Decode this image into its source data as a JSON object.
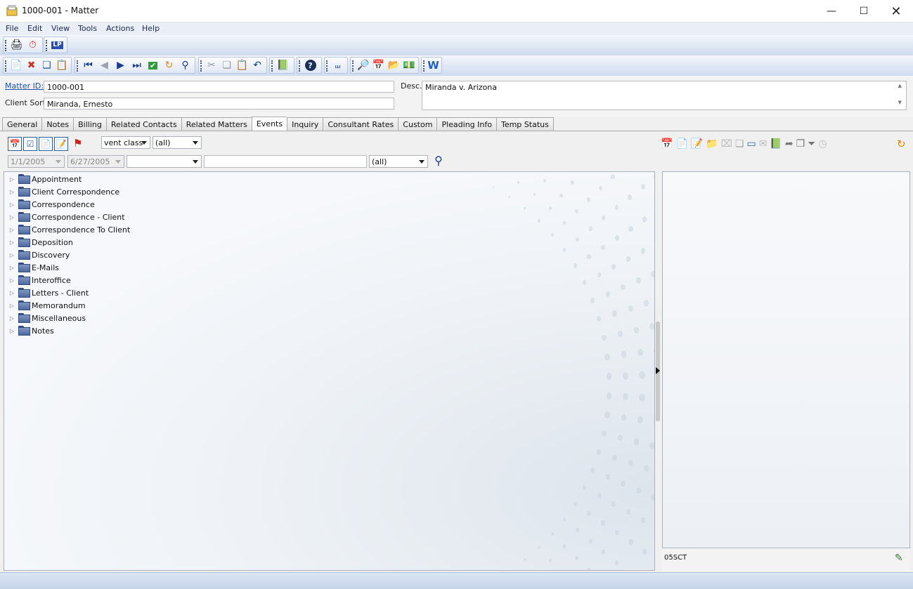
{
  "window": {
    "title": "1000-001 - Matter"
  },
  "menu": [
    "File",
    "Edit",
    "View",
    "Tools",
    "Actions",
    "Help"
  ],
  "toolbar1": {
    "lp_label": "LP"
  },
  "toolbar2": {
    "word_label": "W"
  },
  "header": {
    "matter_id_label": "Matter ID:",
    "matter_id_value": "1000-001",
    "client_sort_label": "Client Sort:",
    "client_sort_value": "Miranda, Ernesto",
    "desc_label": "Desc.:",
    "desc_value": "Miranda v. Arizona"
  },
  "tabs": [
    "General",
    "Notes",
    "Billing",
    "Related Contacts",
    "Related Matters",
    "Events",
    "Inquiry",
    "Consultant Rates",
    "Custom",
    "Pleading Info",
    "Temp Status"
  ],
  "active_tab": "Events",
  "events": {
    "class_combo": "vent class",
    "class_filter": "(all)",
    "date_from": "1/1/2005",
    "date_to": "6/27/2005",
    "type_combo": "",
    "search_text": "",
    "status_filter": "(all)"
  },
  "tree": [
    "Appointment",
    "Client Correspondence",
    "Correspondence",
    "Correspondence - Client",
    "Correspondence To Client",
    "Deposition",
    "Discovery",
    "E-Mails",
    "Interoffice",
    "Letters - Client",
    "Memorandum",
    "Miscellaneous",
    "Notes"
  ],
  "right_panel": {
    "footer_code": "05SCT"
  },
  "icons": {
    "calendar": "calendar-icon",
    "check": "check-icon",
    "search": "search-icon",
    "refresh": "refresh-icon",
    "flag": "flag-icon"
  }
}
